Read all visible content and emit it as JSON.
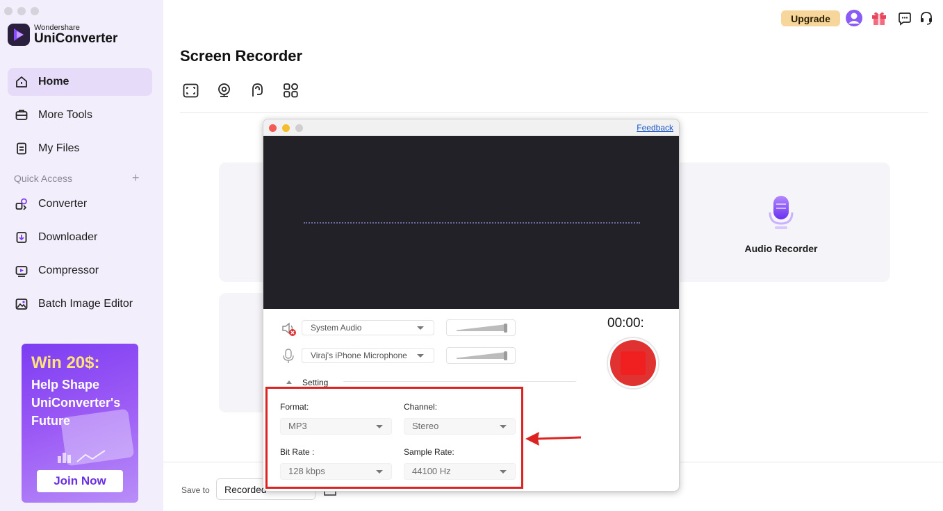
{
  "app": {
    "brand_small": "Wondershare",
    "brand_name": "UniConverter"
  },
  "sidebar": {
    "items": [
      {
        "label": "Home",
        "icon": "home-icon",
        "active": true
      },
      {
        "label": "More Tools",
        "icon": "toolbox-icon"
      },
      {
        "label": "My Files",
        "icon": "file-icon"
      }
    ],
    "quick_access_label": "Quick Access",
    "quick_items": [
      {
        "label": "Converter",
        "icon": "converter-icon"
      },
      {
        "label": "Downloader",
        "icon": "downloader-icon"
      },
      {
        "label": "Compressor",
        "icon": "compressor-icon"
      },
      {
        "label": "Batch Image Editor",
        "icon": "image-editor-icon"
      }
    ]
  },
  "promo": {
    "title": "Win 20$:",
    "subtitle": "Help Shape UniConverter's Future",
    "button": "Join Now"
  },
  "topbar": {
    "upgrade": "Upgrade"
  },
  "main": {
    "title": "Screen Recorder",
    "audio_recorder_label": "Audio Recorder",
    "save_to_label": "Save to",
    "save_to_value": "Recorded"
  },
  "recorder": {
    "feedback": "Feedback",
    "system_audio": "System Audio",
    "microphone": "Viraj's iPhone Microphone",
    "timer": "00:00:",
    "setting_label": "Setting",
    "format_label": "Format:",
    "format_value": "MP3",
    "channel_label": "Channel:",
    "channel_value": "Stereo",
    "bitrate_label": "Bit Rate :",
    "bitrate_value": "128 kbps",
    "samplerate_label": "Sample Rate:",
    "samplerate_value": "44100 Hz"
  },
  "colors": {
    "accent": "#7c3df2",
    "record": "#e13232",
    "highlight": "#dd2222"
  }
}
